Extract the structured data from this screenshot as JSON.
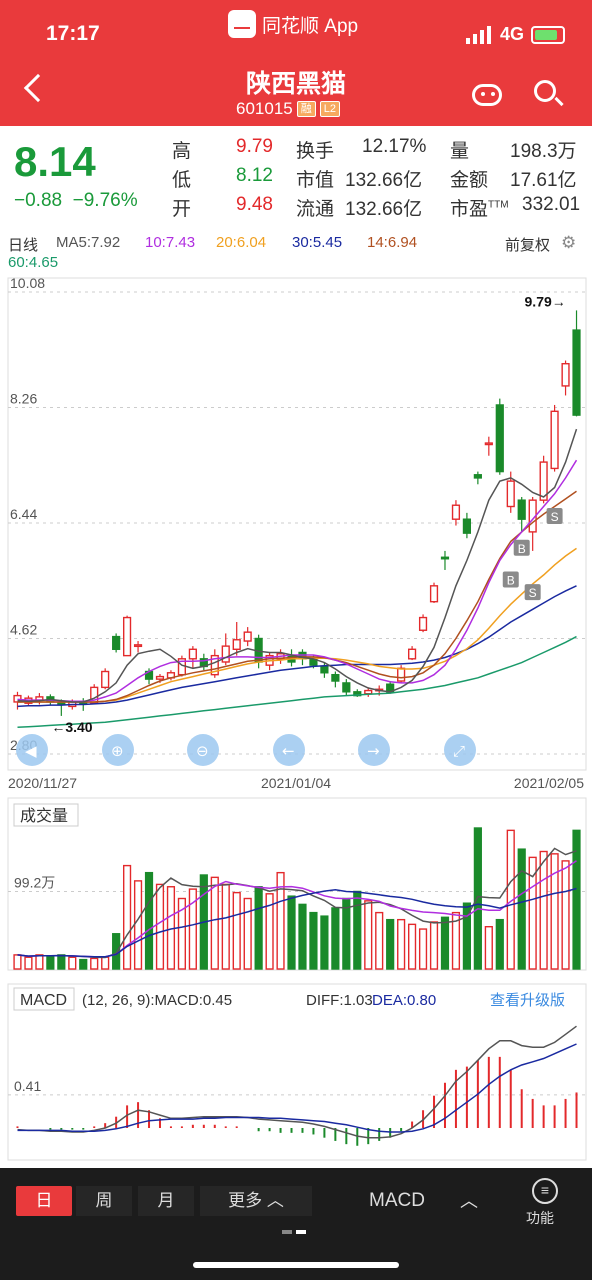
{
  "status": {
    "time": "17:17",
    "app": "同花顺 App",
    "network": "4G"
  },
  "header": {
    "title": "陕西黑猫",
    "code": "601015",
    "tag1": "融",
    "tag2": "L2"
  },
  "quote": {
    "price": "8.14",
    "change": "−0.88",
    "change_pct": "−9.76%",
    "high_label": "高",
    "high": "9.79",
    "low_label": "低",
    "low": "8.12",
    "open_label": "开",
    "open": "9.48",
    "turnover_label": "换手",
    "turnover": "12.17%",
    "mktcap_label": "市值",
    "mktcap": "132.66亿",
    "float_label": "流通",
    "float": "132.66亿",
    "vol_label": "量",
    "vol": "198.3万",
    "amount_label": "金额",
    "amount": "17.61亿",
    "pe_label": "市盈",
    "pe_sup": "TTM",
    "pe": "332.01"
  },
  "ma_legend": {
    "period": "日线",
    "ma5": "MA5:7.92",
    "ma10": "10:7.43",
    "ma20": "20:6.04",
    "ma30": "30:5.45",
    "ma14": "14:6.94",
    "ma60": "60:4.65",
    "adjust": "前复权"
  },
  "colors": {
    "up": "#e3292b",
    "down": "#1a8a2a",
    "ma5": "#555555",
    "ma10": "#b02ee0",
    "ma20": "#f0a020",
    "ma30": "#1a2aa0",
    "ma14": "#b05020",
    "ma60": "#1a9a6a",
    "accent": "#e93a3c"
  },
  "chart_data": {
    "type": "candlestick",
    "price_axis": {
      "labels": [
        "10.08",
        "8.26",
        "6.44",
        "4.62",
        "2.80"
      ],
      "ylim": [
        2.8,
        10.08
      ]
    },
    "date_labels": [
      "2020/11/27",
      "2021/01/04",
      "2021/02/05"
    ],
    "max_marker": "9.79→",
    "min_marker": "←3.40",
    "candles": [
      [
        3.62,
        3.72,
        3.5,
        3.78
      ],
      [
        3.6,
        3.68,
        3.56,
        3.72
      ],
      [
        3.65,
        3.7,
        3.58,
        3.76
      ],
      [
        3.7,
        3.62,
        3.58,
        3.74
      ],
      [
        3.62,
        3.58,
        3.4,
        3.66
      ],
      [
        3.55,
        3.62,
        3.5,
        3.66
      ],
      [
        3.62,
        3.6,
        3.48,
        3.68
      ],
      [
        3.6,
        3.85,
        3.58,
        3.9
      ],
      [
        3.85,
        4.1,
        3.82,
        4.15
      ],
      [
        4.65,
        4.45,
        4.4,
        4.7
      ],
      [
        4.35,
        4.95,
        4.35,
        4.98
      ],
      [
        4.5,
        4.52,
        4.4,
        4.58
      ],
      [
        4.1,
        3.98,
        3.9,
        4.15
      ],
      [
        3.98,
        4.02,
        3.92,
        4.06
      ],
      [
        4.0,
        4.08,
        3.96,
        4.12
      ],
      [
        4.05,
        4.3,
        4.02,
        4.35
      ],
      [
        4.3,
        4.45,
        4.15,
        4.5
      ],
      [
        4.3,
        4.18,
        4.12,
        4.38
      ],
      [
        4.05,
        4.35,
        4.0,
        4.45
      ],
      [
        4.25,
        4.5,
        4.2,
        4.7
      ],
      [
        4.45,
        4.6,
        4.35,
        4.88
      ],
      [
        4.58,
        4.72,
        4.5,
        4.8
      ],
      [
        4.62,
        4.25,
        4.15,
        4.68
      ],
      [
        4.2,
        4.35,
        4.12,
        4.4
      ],
      [
        4.3,
        4.38,
        4.22,
        4.45
      ],
      [
        4.35,
        4.25,
        4.18,
        4.45
      ],
      [
        4.4,
        4.3,
        4.2,
        4.45
      ],
      [
        4.3,
        4.2,
        4.15,
        4.35
      ],
      [
        4.18,
        4.08,
        4.0,
        4.25
      ],
      [
        4.05,
        3.95,
        3.85,
        4.1
      ],
      [
        3.92,
        3.78,
        3.72,
        3.98
      ],
      [
        3.78,
        3.72,
        3.7,
        3.82
      ],
      [
        3.75,
        3.8,
        3.7,
        3.85
      ],
      [
        3.8,
        3.82,
        3.72,
        3.88
      ],
      [
        3.9,
        3.78,
        3.75,
        3.95
      ],
      [
        3.95,
        4.15,
        3.92,
        4.2
      ],
      [
        4.3,
        4.45,
        4.28,
        4.5
      ],
      [
        4.75,
        4.95,
        4.72,
        5.0
      ],
      [
        5.2,
        5.45,
        5.18,
        5.5
      ],
      [
        5.9,
        5.88,
        5.7,
        6.0
      ],
      [
        6.5,
        6.72,
        6.4,
        6.8
      ],
      [
        6.5,
        6.28,
        6.2,
        6.6
      ],
      [
        7.2,
        7.15,
        7.05,
        7.25
      ],
      [
        7.7,
        7.7,
        7.5,
        7.8
      ],
      [
        8.3,
        7.25,
        7.2,
        8.4
      ],
      [
        6.7,
        7.1,
        6.6,
        7.25
      ],
      [
        6.8,
        6.5,
        6.3,
        6.85
      ],
      [
        6.3,
        6.8,
        6.0,
        6.85
      ],
      [
        6.8,
        7.4,
        6.75,
        7.5
      ],
      [
        7.3,
        8.2,
        7.25,
        8.3
      ],
      [
        8.6,
        8.95,
        8.45,
        9.0
      ],
      [
        9.48,
        8.14,
        8.12,
        9.79
      ]
    ],
    "ma5": [
      3.64,
      3.63,
      3.64,
      3.66,
      3.64,
      3.62,
      3.62,
      3.68,
      3.78,
      3.92,
      4.2,
      4.38,
      4.42,
      4.45,
      4.34,
      4.2,
      4.15,
      4.18,
      4.24,
      4.32,
      4.4,
      4.46,
      4.42,
      4.4,
      4.4,
      4.36,
      4.32,
      4.3,
      4.24,
      4.14,
      4.02,
      3.92,
      3.84,
      3.8,
      3.78,
      3.85,
      3.96,
      4.18,
      4.48,
      4.95,
      5.45,
      5.85,
      6.3,
      6.8,
      7.1,
      7.15,
      7.05,
      6.92,
      6.85,
      7.0,
      7.4,
      7.92
    ],
    "ma10": [
      3.66,
      3.65,
      3.65,
      3.65,
      3.64,
      3.63,
      3.63,
      3.65,
      3.7,
      3.76,
      3.88,
      4.0,
      4.1,
      4.18,
      4.24,
      4.26,
      4.26,
      4.27,
      4.3,
      4.32,
      4.33,
      4.33,
      4.32,
      4.32,
      4.34,
      4.36,
      4.36,
      4.36,
      4.33,
      4.28,
      4.22,
      4.14,
      4.06,
      3.98,
      3.94,
      3.92,
      3.92,
      3.96,
      4.05,
      4.2,
      4.45,
      4.75,
      5.1,
      5.5,
      5.85,
      6.1,
      6.3,
      6.5,
      6.7,
      6.9,
      7.15,
      7.43
    ],
    "ma20": [
      3.62,
      3.62,
      3.62,
      3.62,
      3.62,
      3.62,
      3.62,
      3.62,
      3.63,
      3.65,
      3.7,
      3.76,
      3.82,
      3.88,
      3.94,
      3.98,
      4.02,
      4.06,
      4.1,
      4.14,
      4.18,
      4.22,
      4.25,
      4.27,
      4.28,
      4.3,
      4.3,
      4.31,
      4.31,
      4.3,
      4.28,
      4.25,
      4.22,
      4.18,
      4.16,
      4.14,
      4.14,
      4.15,
      4.2,
      4.26,
      4.35,
      4.46,
      4.6,
      4.78,
      4.98,
      5.16,
      5.32,
      5.48,
      5.62,
      5.78,
      5.92,
      6.04
    ],
    "ma30": [
      3.55,
      3.56,
      3.56,
      3.57,
      3.57,
      3.58,
      3.58,
      3.59,
      3.6,
      3.62,
      3.65,
      3.69,
      3.73,
      3.77,
      3.81,
      3.85,
      3.88,
      3.91,
      3.94,
      3.97,
      4.0,
      4.03,
      4.06,
      4.09,
      4.12,
      4.14,
      4.16,
      4.18,
      4.19,
      4.2,
      4.21,
      4.21,
      4.21,
      4.21,
      4.21,
      4.22,
      4.23,
      4.25,
      4.28,
      4.32,
      4.38,
      4.45,
      4.54,
      4.64,
      4.76,
      4.88,
      4.98,
      5.08,
      5.18,
      5.28,
      5.37,
      5.45
    ],
    "ma60": [
      3.22,
      3.23,
      3.24,
      3.25,
      3.26,
      3.27,
      3.28,
      3.29,
      3.3,
      3.32,
      3.34,
      3.36,
      3.38,
      3.4,
      3.42,
      3.44,
      3.46,
      3.48,
      3.5,
      3.52,
      3.54,
      3.56,
      3.58,
      3.6,
      3.62,
      3.64,
      3.66,
      3.68,
      3.7,
      3.71,
      3.72,
      3.73,
      3.74,
      3.75,
      3.76,
      3.78,
      3.8,
      3.82,
      3.85,
      3.88,
      3.92,
      3.96,
      4.0,
      4.06,
      4.12,
      4.18,
      4.24,
      4.32,
      4.4,
      4.48,
      4.56,
      4.65
    ],
    "ma14": [
      3.62,
      3.62,
      3.62,
      3.62,
      3.62,
      3.62,
      3.62,
      3.62,
      3.63,
      3.66,
      3.72,
      3.8,
      3.88,
      3.95,
      4.0,
      4.04,
      4.08,
      4.11,
      4.14,
      4.18,
      4.22,
      4.26,
      4.28,
      4.3,
      4.31,
      4.32,
      4.33,
      4.33,
      4.32,
      4.28,
      4.24,
      4.18,
      4.12,
      4.06,
      4.02,
      4.0,
      4.02,
      4.08,
      4.2,
      4.38,
      4.62,
      4.9,
      5.2,
      5.55,
      5.88,
      6.15,
      6.3,
      6.45,
      6.58,
      6.7,
      6.82,
      6.94
    ],
    "volume": {
      "label": "成交量",
      "axis_label": "99.2万",
      "values": [
        12,
        10,
        12,
        11,
        12,
        10,
        8,
        9,
        10,
        30,
        88,
        75,
        82,
        72,
        70,
        60,
        68,
        80,
        78,
        72,
        65,
        60,
        70,
        64,
        82,
        62,
        55,
        48,
        45,
        52,
        60,
        66,
        58,
        48,
        42,
        42,
        38,
        34,
        40,
        44,
        48,
        56,
        120,
        36,
        42,
        118,
        102,
        95,
        100,
        98,
        92,
        118
      ]
    },
    "macd": {
      "label": "MACD",
      "params": "(12, 26, 9):MACD:0.45",
      "diff": "DIFF:1.03",
      "dea": "DEA:0.80",
      "upgrade": "查看升级版",
      "axis_label": "0.41",
      "diff_vals": [
        -0.02,
        -0.03,
        -0.03,
        -0.04,
        -0.04,
        -0.05,
        -0.05,
        -0.03,
        0.0,
        0.06,
        0.16,
        0.22,
        0.2,
        0.16,
        0.12,
        0.12,
        0.13,
        0.14,
        0.14,
        0.14,
        0.14,
        0.13,
        0.11,
        0.1,
        0.09,
        0.08,
        0.07,
        0.05,
        0.02,
        -0.02,
        -0.06,
        -0.1,
        -0.12,
        -0.12,
        -0.11,
        -0.07,
        0.0,
        0.1,
        0.24,
        0.4,
        0.58,
        0.7,
        0.84,
        0.98,
        1.08,
        1.08,
        1.02,
        1.0,
        1.0,
        1.06,
        1.16,
        1.26
      ],
      "dea_vals": [
        -0.03,
        -0.03,
        -0.03,
        -0.03,
        -0.03,
        -0.04,
        -0.04,
        -0.04,
        -0.03,
        -0.01,
        0.02,
        0.06,
        0.09,
        0.1,
        0.11,
        0.11,
        0.11,
        0.12,
        0.12,
        0.13,
        0.13,
        0.13,
        0.13,
        0.12,
        0.12,
        0.11,
        0.1,
        0.09,
        0.08,
        0.06,
        0.04,
        0.01,
        -0.02,
        -0.04,
        -0.05,
        -0.05,
        -0.04,
        -0.01,
        0.04,
        0.12,
        0.22,
        0.32,
        0.42,
        0.54,
        0.64,
        0.72,
        0.78,
        0.82,
        0.86,
        0.92,
        0.98,
        1.04
      ]
    }
  },
  "bottom": {
    "tab_day": "日",
    "tab_week": "周",
    "tab_month": "月",
    "tab_more": "更多",
    "indicator": "MACD",
    "func": "功能"
  },
  "nav": {
    "bs_tags": [
      "B",
      "S",
      "B",
      "S"
    ]
  }
}
